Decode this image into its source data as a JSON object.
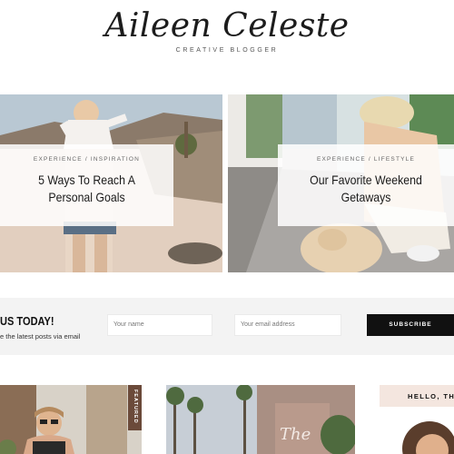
{
  "brand": {
    "logo": "Aileen Celeste",
    "tagline": "CREATIVE BLOGGER"
  },
  "posts": [
    {
      "category": "EXPERIENCE / INSPIRATION",
      "title": "5 Ways To Reach A Personal Goals"
    },
    {
      "category": "EXPERIENCE / LIFESTYLE",
      "title": "Our Favorite Weekend Getaways"
    }
  ],
  "subscribe": {
    "heading": "US TODAY!",
    "text": "e the latest posts via email",
    "name_placeholder": "Your name",
    "email_placeholder": "Your email address",
    "button": "SUBSCRIBE"
  },
  "featured_label": "FEATURED",
  "hello_label": "HELLO, THE",
  "colors": {
    "accent_dark": "#111111",
    "featured_tag": "#6b4a3a",
    "hello_bg": "#f4e6df",
    "subscribe_bg": "#f3f3f3"
  }
}
